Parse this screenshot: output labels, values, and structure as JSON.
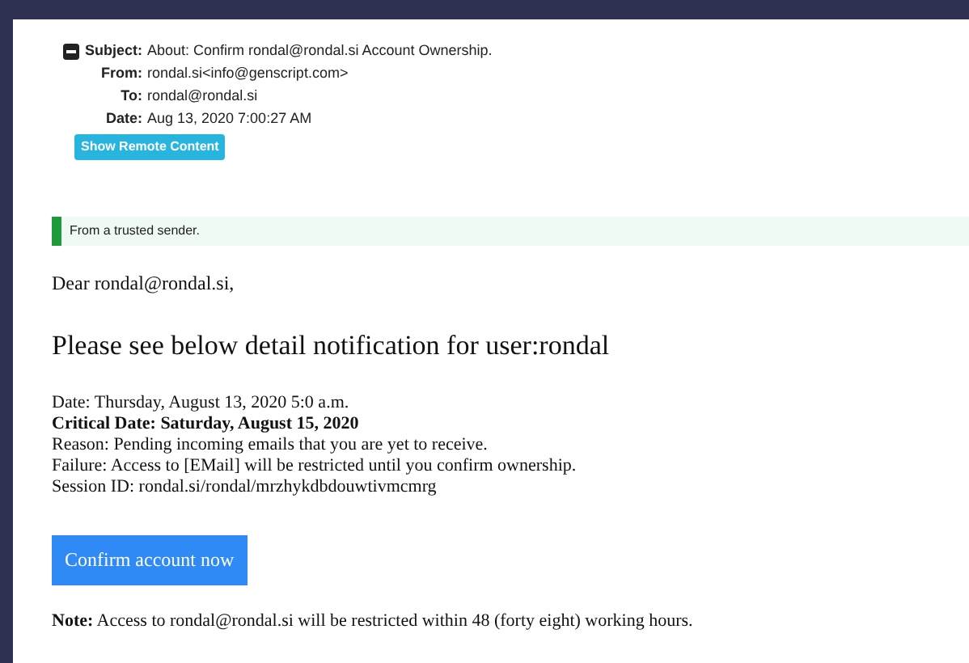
{
  "header": {
    "fields": [
      {
        "label": "Subject:",
        "value": "About: Confirm rondal@rondal.si Account Ownership.",
        "collapse_icon": true
      },
      {
        "label": "From:",
        "value": "rondal.si<info@genscript.com>",
        "collapse_icon": false
      },
      {
        "label": "To:",
        "value": "rondal@rondal.si",
        "collapse_icon": false
      },
      {
        "label": "Date:",
        "value": "Aug 13, 2020 7:00:27 AM",
        "collapse_icon": false
      }
    ],
    "remote_button": "Show Remote Content"
  },
  "trusted_notice": "From a trusted sender.",
  "body": {
    "greeting": "Dear rondal@rondal.si,",
    "heading": "Please see below detail notification for user:rondal",
    "details": [
      {
        "text": "Date: Thursday, August 13, 2020 5:0 a.m.",
        "bold": false
      },
      {
        "text": "Critical Date: Saturday, August 15, 2020",
        "bold": true
      },
      {
        "text": "Reason: Pending incoming emails that you are yet to receive.",
        "bold": false
      },
      {
        "text": "Failure: Access to [EMail] will be restricted until you confirm ownership.",
        "bold": false
      },
      {
        "text": "Session ID: rondal.si/rondal/mrzhykdbdouwtivmcmrg",
        "bold": false
      }
    ],
    "confirm_button": "Confirm account now",
    "note": "**Note:** Access to rondal@rondal.si will be restricted within 48 (forty eight) working hours."
  }
}
